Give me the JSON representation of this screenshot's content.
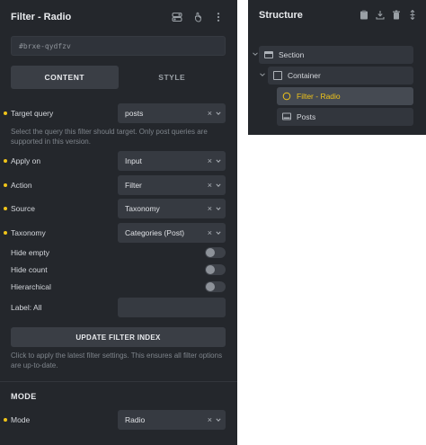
{
  "panel": {
    "title": "Filter - Radio",
    "element_id": "#brxe-qydfzv",
    "tabs": [
      {
        "label": "CONTENT",
        "active": true
      },
      {
        "label": "STYLE",
        "active": false
      }
    ]
  },
  "fields": {
    "target_query": {
      "label": "Target query",
      "value": "posts"
    },
    "target_query_help": "Select the query this filter should target. Only post queries are supported in this version.",
    "apply_on": {
      "label": "Apply on",
      "value": "Input"
    },
    "action": {
      "label": "Action",
      "value": "Filter"
    },
    "source": {
      "label": "Source",
      "value": "Taxonomy"
    },
    "taxonomy": {
      "label": "Taxonomy",
      "value": "Categories (Post)"
    },
    "hide_empty": {
      "label": "Hide empty",
      "on": false
    },
    "hide_count": {
      "label": "Hide count",
      "on": false
    },
    "hierarchical": {
      "label": "Hierarchical",
      "on": false
    },
    "label_all": {
      "label": "Label: All",
      "value": ""
    }
  },
  "update_button": {
    "label": "UPDATE FILTER INDEX",
    "help": "Click to apply the latest filter settings. This ensures all filter options are up-to-date."
  },
  "mode_section": {
    "title": "MODE",
    "mode": {
      "label": "Mode",
      "value": "Radio"
    }
  },
  "structure": {
    "title": "Structure",
    "items": [
      {
        "label": "Section",
        "icon": "section-icon"
      },
      {
        "label": "Container",
        "icon": "container-icon"
      },
      {
        "label": "Filter - Radio",
        "icon": "radio-icon",
        "selected": true
      },
      {
        "label": "Posts",
        "icon": "posts-icon"
      }
    ]
  },
  "colors": {
    "panel_bg": "#24272c",
    "field_bg": "#363a41",
    "accent": "#f0c419"
  }
}
